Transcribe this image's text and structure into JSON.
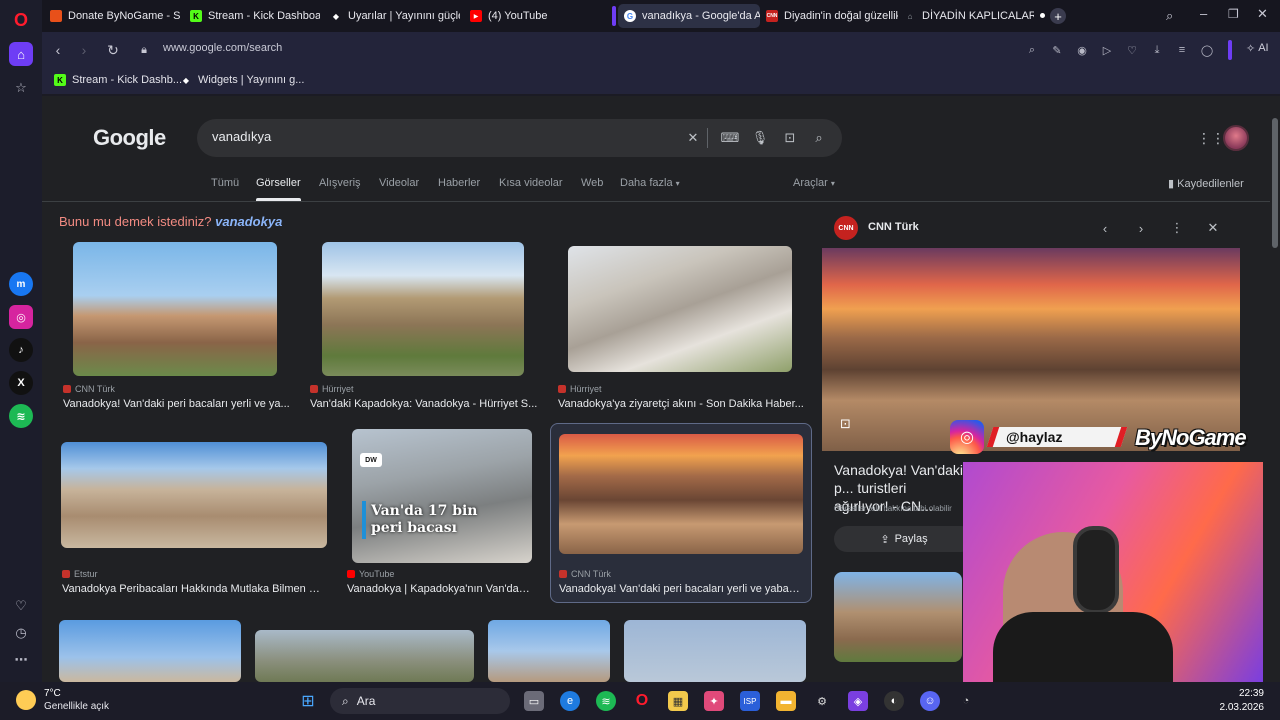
{
  "browser": {
    "tabs": [
      {
        "label": "Donate ByNoGame - Strea",
        "icon_color": "#e8501a",
        "icon": "bynogame-icon"
      },
      {
        "label": "Stream - Kick Dashboard",
        "icon_color": "#53fc18",
        "icon": "kick-icon"
      },
      {
        "label": "Uyarılar | Yayınını güçlendi",
        "icon_color": "#ffffff",
        "icon": "widgets-icon"
      },
      {
        "label": "(4) YouTube",
        "icon_color": "#ff0000",
        "icon": "youtube-icon"
      },
      {
        "label": "vanadıkya - Google'da Ara",
        "icon_color": "#4285f4",
        "icon": "google-icon",
        "active": true
      },
      {
        "label": "Diyadin'in doğal güzellikle",
        "icon_color": "#c5221f",
        "icon": "cnn-icon"
      },
      {
        "label": "DİYADİN KAPLICALARI | K",
        "icon_color": "#9aa0a6",
        "icon": "site-icon"
      }
    ],
    "url": "www.google.com/search",
    "ai_label": "AI",
    "bookmarks": [
      {
        "label": "Stream - Kick Dashb...",
        "icon_color": "#53fc18"
      },
      {
        "label": "Widgets | Yayınını g...",
        "icon_color": "#ffffff"
      }
    ]
  },
  "google": {
    "logo": "Google",
    "query": "vanadıkya",
    "nav_tabs": [
      "Tümü",
      "Görseller",
      "Alışveriş",
      "Videolar",
      "Haberler",
      "Kısa videolar",
      "Web",
      "Daha fazla"
    ],
    "tools_label": "Araçlar",
    "saved_label": "Kaydedilenler",
    "did_you_mean": "Bunu mu demek istediniz?",
    "suggestion": "vanadokya",
    "results": [
      {
        "source": "CNN Türk",
        "title": "Vanadokya! Van'daki peri bacaları yerli ve ya..."
      },
      {
        "source": "Hürriyet",
        "title": "Van'daki Kapadokya: Vanadokya - Hürriyet S..."
      },
      {
        "source": "Hürriyet",
        "title": "Vanadokya'ya ziyaretçi akını - Son Dakika Haber..."
      },
      {
        "source": "Etstur",
        "title": "Vanadokya Peribacaları Hakkında Mutlaka Bilmen G..."
      },
      {
        "source": "YouTube",
        "title": "Vanadokya | Kapadokya'nın Van'daki...",
        "overlay": "Van'da 17 bin peri bacası"
      },
      {
        "source": "CNN Türk",
        "title": "Vanadokya! Van'daki peri bacaları yerli ve yaban..."
      }
    ],
    "panel": {
      "source": "CNN Türk",
      "logo_text": "CNN",
      "title": "Vanadokya! Van'daki p... turistleri ağırlıyor! - CN...",
      "note": "Görseller telif hakkına tabi olabilir",
      "share_label": "Paylaş"
    }
  },
  "overlay": {
    "handle": "@haylaz",
    "brand": "ByNoGame"
  },
  "taskbar": {
    "temperature": "7°C",
    "weather": "Genellikle açık",
    "search_label": "Ara",
    "time": "22:39",
    "date": "2.03.2026"
  }
}
